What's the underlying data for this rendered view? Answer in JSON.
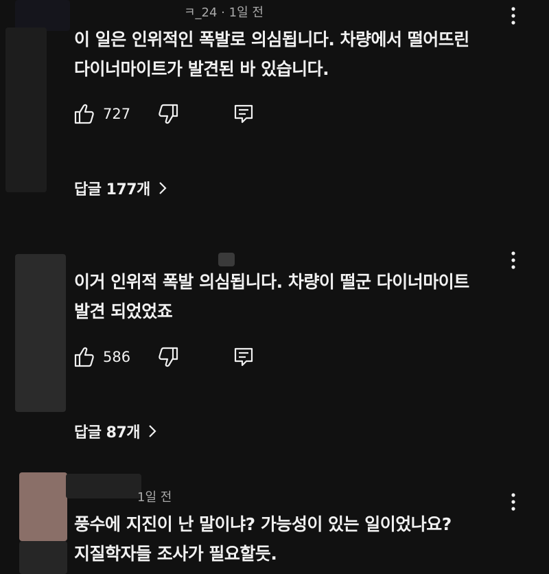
{
  "comments": [
    {
      "meta": "ㅋ_24 · 1일 전",
      "text": "이 일은 인위적인 폭발로 의심됩니다. 차량에서 떨어뜨린\n다이너마이트가 발견된 바 있습니다.",
      "likes": "727",
      "replies_label": "답글 177개"
    },
    {
      "meta": "",
      "text": "이거 인위적 폭발 의심됩니다. 차량이 떨군 다이너마이트\n발견 되었었죠",
      "likes": "586",
      "replies_label": "답글 87개"
    },
    {
      "meta": "1일 전",
      "text": "풍수에 지진이 난 말이냐? 가능성이 있는 일이었나요?\n지질학자들 조사가 필요할듯.",
      "likes": "",
      "replies_label": ""
    }
  ],
  "icons": {
    "like": "thumbs-up-icon",
    "dislike": "thumbs-down-icon",
    "reply": "reply-comment-icon",
    "more": "more-vert-icon",
    "chevron": "chevron-right-icon"
  },
  "colors": {
    "background": "#111111",
    "text": "#f1f1f1",
    "secondary": "#aaaaaa"
  }
}
